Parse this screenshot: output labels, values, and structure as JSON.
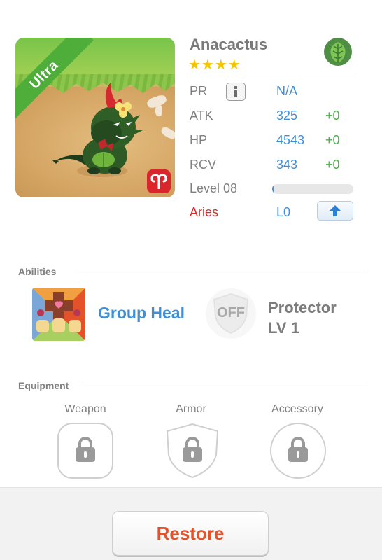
{
  "monster": {
    "name": "Anacactus",
    "stars": "★★★★",
    "rarity": "Ultra",
    "element_icon": "leaf-icon",
    "sign_icon": "aries-icon"
  },
  "stats": {
    "pr": {
      "label": "PR",
      "value": "N/A"
    },
    "atk": {
      "label": "ATK",
      "value": "325",
      "bonus": "+0"
    },
    "hp": {
      "label": "HP",
      "value": "4543",
      "bonus": "+0"
    },
    "rcv": {
      "label": "RCV",
      "value": "343",
      "bonus": "+0"
    },
    "level": {
      "label": "Level 08",
      "progress": 0.03
    },
    "sign": {
      "label": "Aries",
      "value": "L0"
    }
  },
  "abilities": {
    "title": "Abilities",
    "active": {
      "name": "Group Heal",
      "icon": "group-heal-icon"
    },
    "passive": {
      "badge": "OFF",
      "line1": "Protector",
      "line2": "LV 1"
    }
  },
  "equipment": {
    "title": "Equipment",
    "slots": [
      {
        "label": "Weapon",
        "state": "locked"
      },
      {
        "label": "Armor",
        "state": "locked"
      },
      {
        "label": "Accessory",
        "state": "locked"
      }
    ]
  },
  "footer": {
    "restore_label": "Restore"
  },
  "colors": {
    "accent_blue": "#3e8fd8",
    "bonus_green": "#49b044",
    "sign_red": "#d62b2b",
    "restore_orange": "#e3532b",
    "ultra_green": "#4fae3a"
  }
}
